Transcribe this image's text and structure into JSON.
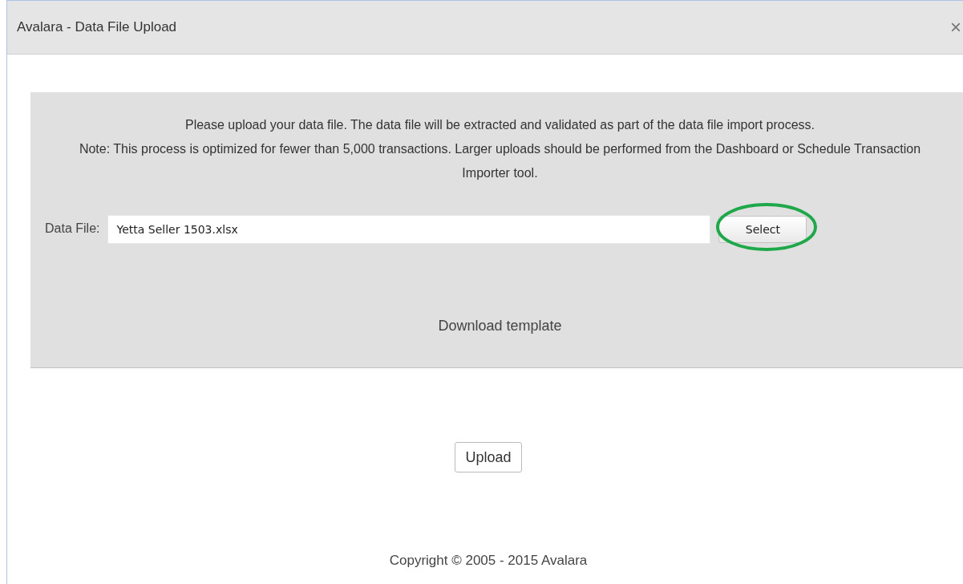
{
  "window": {
    "title": "Avalara - Data File Upload",
    "close": "×"
  },
  "intro": [
    "Please upload your data file. The data file will be extracted and validated as part of the data file import process.",
    "Note: This process is optimized for fewer than 5,000 transactions. Larger uploads should be performed from the Dashboard or Schedule Transaction Importer tool."
  ],
  "data_file": {
    "label": "Data File:",
    "value": "Yetta Seller 1503.xlsx",
    "button": {
      "label": "Select",
      "highlighted": true
    }
  },
  "template_link": "Download template",
  "upload_button": "Upload",
  "footer": "Copyright © 2005 - 2015 Avalara"
}
